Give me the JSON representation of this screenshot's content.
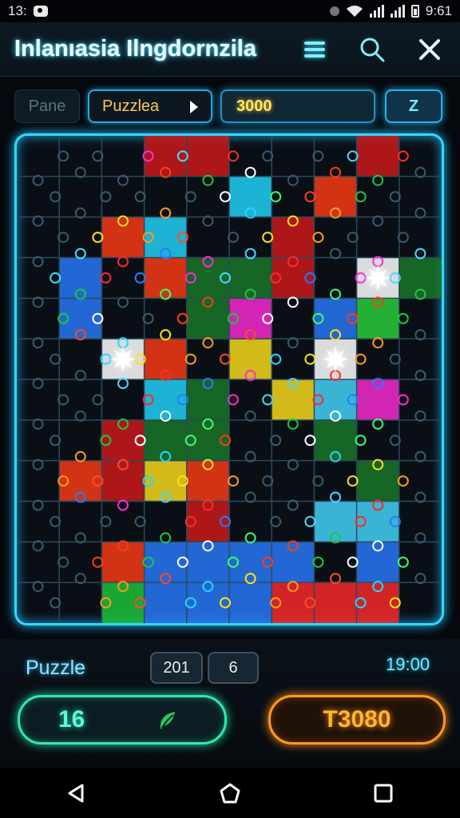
{
  "status_bar": {
    "time": "13:",
    "clock": "9:61"
  },
  "app_bar": {
    "title": "Inlanıasia Ilngdornzila"
  },
  "toolbar": {
    "pane_label": "Pane",
    "puzzle_select": "Puzzlea",
    "score": "3000",
    "z_button": "Z"
  },
  "board": {
    "cols": 10,
    "rows": 11,
    "glow_colors": [
      "#ff2a2a",
      "#ff3c14",
      "#22d8ff",
      "#2a7bff",
      "#1ec83c",
      "#ffe01a",
      "#ff2bd6",
      "#ffffff",
      "#ff9a1c",
      "#46d9ff",
      "#3bff6a",
      "#ff4a2a"
    ],
    "cells": [
      [
        null,
        null,
        null,
        "#d21a1a",
        "#d21a1a",
        null,
        null,
        null,
        "#d21a1a",
        null
      ],
      [
        null,
        null,
        null,
        null,
        null,
        "#22d8ff",
        null,
        "#ff3c14",
        null,
        null
      ],
      [
        null,
        null,
        "#ff3c14",
        "#22d8ff",
        null,
        null,
        "#d21a1a",
        null,
        null,
        null
      ],
      [
        null,
        "#2a7bff",
        null,
        "#ff3c14",
        "#1a7a2a",
        "#1a7a2a",
        "#d21a1a",
        null,
        "#ffffff",
        "#1a7a2a"
      ],
      [
        null,
        "#2a7bff",
        null,
        null,
        "#1a7a2a",
        "#ff2bd6",
        null,
        "#2a7bff",
        "#2ad43c",
        null
      ],
      [
        null,
        null,
        "#ffffff",
        "#ff3c14",
        null,
        "#ffe01a",
        null,
        "#ffffff",
        null,
        null
      ],
      [
        null,
        null,
        null,
        "#22d8ff",
        "#1a7a2a",
        null,
        "#ffe01a",
        "#46d9ff",
        "#ff2bd6",
        null
      ],
      [
        null,
        null,
        "#d21a1a",
        "#1a7a2a",
        "#1a7a2a",
        null,
        null,
        "#1a7a2a",
        null,
        null
      ],
      [
        null,
        "#ff3c14",
        "#d21a1a",
        "#ffe01a",
        "#ff3c14",
        null,
        null,
        null,
        "#1a7a2a",
        null
      ],
      [
        null,
        null,
        null,
        null,
        "#d21a1a",
        null,
        null,
        "#46d9ff",
        "#46d9ff",
        null
      ],
      [
        null,
        null,
        "#ff3c14",
        "#2a7bff",
        "#2a7bff",
        "#2a7bff",
        "#2a7bff",
        null,
        "#2a7bff",
        null
      ],
      [
        null,
        null,
        "#1ec83c",
        "#2a7bff",
        "#2a7bff",
        "#2a7bff",
        "#ff2a2a",
        "#ff2a2a",
        "#ff2a2a",
        null
      ]
    ]
  },
  "stats": {
    "label": "Puzzle",
    "chip_a": "201",
    "chip_b": "6",
    "timer": "19:00"
  },
  "actions": {
    "green_value": "16",
    "orange_value": "T3080"
  },
  "icons": {
    "menu": "hamburger-menu-icon",
    "search": "search-icon",
    "close": "close-icon",
    "back": "back-triangle-icon",
    "home": "home-icon",
    "recents": "recents-square-icon",
    "leaf": "leaf-icon"
  }
}
